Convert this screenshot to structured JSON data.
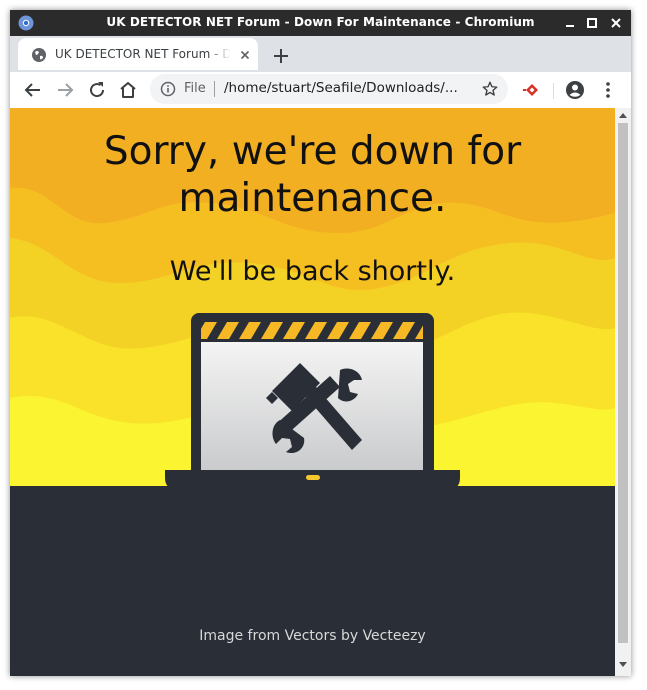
{
  "window": {
    "title": "UK DETECTOR NET Forum - Down For Maintenance - Chromium",
    "controls": [
      "minimize-icon",
      "maximize-icon",
      "close-icon"
    ]
  },
  "tabs": [
    {
      "label": "UK DETECTOR NET Forum - Down For Maintenance",
      "icon": "globe-icon",
      "active": true
    }
  ],
  "toolbar": {
    "buttons": [
      "back-arrow-icon",
      "forward-arrow-icon",
      "reload-icon",
      "home-icon"
    ],
    "address": {
      "scheme_label": "File",
      "url": "/home/stuart/Seafile/Downloads/..."
    },
    "extensions": [
      "diamond-extension-icon",
      "account-icon",
      "menu-kebab-icon"
    ]
  },
  "page": {
    "heading_line1": "Sorry, we're down for",
    "heading_line2": "maintenance.",
    "subheading": "We'll be back shortly.",
    "illustration": "laptop-with-hammer-and-wrench",
    "credit": "Image from Vectors by Vecteezy"
  },
  "colors": {
    "titlebar": "#2b2b2b",
    "hero_orange": "#f2af22",
    "hero_yellow": "#f9ef2c",
    "footer": "#2a2e36",
    "laptop_dark": "#2a2e36",
    "stripe_yellow": "#f7b825",
    "extension_red": "#d93025"
  }
}
